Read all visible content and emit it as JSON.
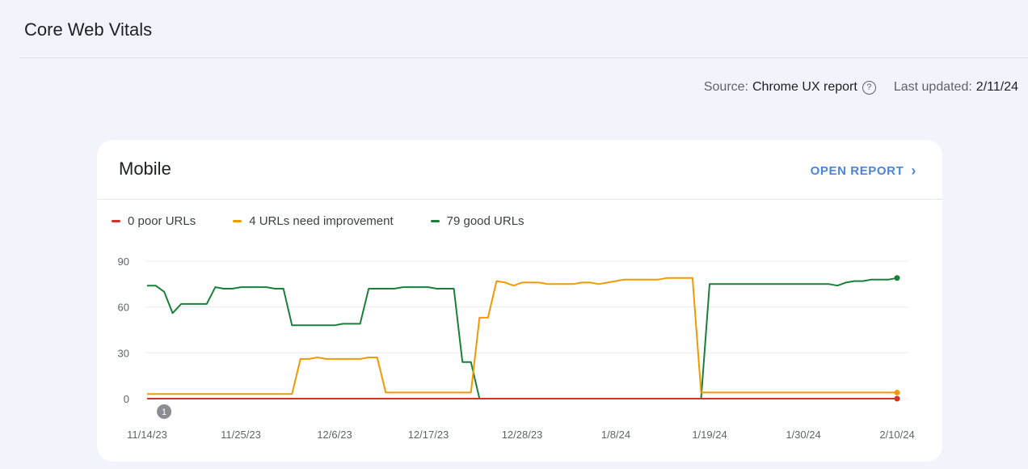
{
  "page": {
    "title": "Core Web Vitals",
    "source_label": "Source:",
    "source_value": "Chrome UX report",
    "updated_label": "Last updated:",
    "updated_value": "2/11/24"
  },
  "card": {
    "title": "Mobile",
    "open_report_label": "OPEN REPORT"
  },
  "colors": {
    "poor": "#d93025",
    "needs_improvement": "#f29900",
    "good": "#188038"
  },
  "chart_data": {
    "type": "line",
    "title": "",
    "xlabel": "",
    "ylabel": "",
    "ylim": [
      0,
      90
    ],
    "y_ticks": [
      "0",
      "30",
      "60",
      "90"
    ],
    "x_ticks": [
      "11/14/23",
      "11/25/23",
      "12/6/23",
      "12/17/23",
      "12/28/23",
      "1/8/24",
      "1/19/24",
      "1/30/24",
      "2/10/24"
    ],
    "grid": true,
    "legend_position": "top-left",
    "annotations": [
      {
        "label": "1",
        "x": "11/16/23"
      }
    ],
    "series": [
      {
        "name": "0 poor URLs",
        "color": "#d93025",
        "points": [
          [
            "11/14/23",
            0
          ],
          [
            "2/10/24",
            0
          ]
        ]
      },
      {
        "name": "4 URLs need improvement",
        "color": "#f29900",
        "points": [
          [
            "11/14/23",
            3
          ],
          [
            "12/1/23",
            3
          ],
          [
            "12/2/23",
            26
          ],
          [
            "12/3/23",
            26
          ],
          [
            "12/4/23",
            27
          ],
          [
            "12/5/23",
            26
          ],
          [
            "12/9/23",
            26
          ],
          [
            "12/10/23",
            27
          ],
          [
            "12/11/23",
            27
          ],
          [
            "12/12/23",
            4
          ],
          [
            "12/22/23",
            4
          ],
          [
            "12/23/23",
            53
          ],
          [
            "12/24/23",
            53
          ],
          [
            "12/25/23",
            77
          ],
          [
            "12/26/23",
            76
          ],
          [
            "12/27/23",
            74
          ],
          [
            "12/28/23",
            76
          ],
          [
            "12/30/23",
            76
          ],
          [
            "12/31/23",
            75
          ],
          [
            "1/3/24",
            75
          ],
          [
            "1/4/24",
            76
          ],
          [
            "1/5/24",
            76
          ],
          [
            "1/6/24",
            75
          ],
          [
            "1/8/24",
            77
          ],
          [
            "1/9/24",
            78
          ],
          [
            "1/13/24",
            78
          ],
          [
            "1/14/24",
            79
          ],
          [
            "1/17/24",
            79
          ],
          [
            "1/18/24",
            4
          ],
          [
            "2/10/24",
            4
          ]
        ]
      },
      {
        "name": "79 good URLs",
        "color": "#188038",
        "points": [
          [
            "11/14/23",
            74
          ],
          [
            "11/15/23",
            74
          ],
          [
            "11/16/23",
            70
          ],
          [
            "11/17/23",
            56
          ],
          [
            "11/18/23",
            62
          ],
          [
            "11/21/23",
            62
          ],
          [
            "11/22/23",
            73
          ],
          [
            "11/23/23",
            72
          ],
          [
            "11/24/23",
            72
          ],
          [
            "11/25/23",
            73
          ],
          [
            "11/28/23",
            73
          ],
          [
            "11/29/23",
            72
          ],
          [
            "11/30/23",
            72
          ],
          [
            "12/1/23",
            48
          ],
          [
            "12/6/23",
            48
          ],
          [
            "12/7/23",
            49
          ],
          [
            "12/9/23",
            49
          ],
          [
            "12/10/23",
            72
          ],
          [
            "12/13/23",
            72
          ],
          [
            "12/14/23",
            73
          ],
          [
            "12/17/23",
            73
          ],
          [
            "12/18/23",
            72
          ],
          [
            "12/20/23",
            72
          ],
          [
            "12/21/23",
            24
          ],
          [
            "12/22/23",
            24
          ],
          [
            "12/23/23",
            0
          ],
          [
            "1/18/24",
            0
          ],
          [
            "1/19/24",
            75
          ],
          [
            "2/2/24",
            75
          ],
          [
            "2/3/24",
            74
          ],
          [
            "2/4/24",
            76
          ],
          [
            "2/5/24",
            77
          ],
          [
            "2/6/24",
            77
          ],
          [
            "2/7/24",
            78
          ],
          [
            "2/9/24",
            78
          ],
          [
            "2/10/24",
            79
          ]
        ]
      }
    ]
  }
}
